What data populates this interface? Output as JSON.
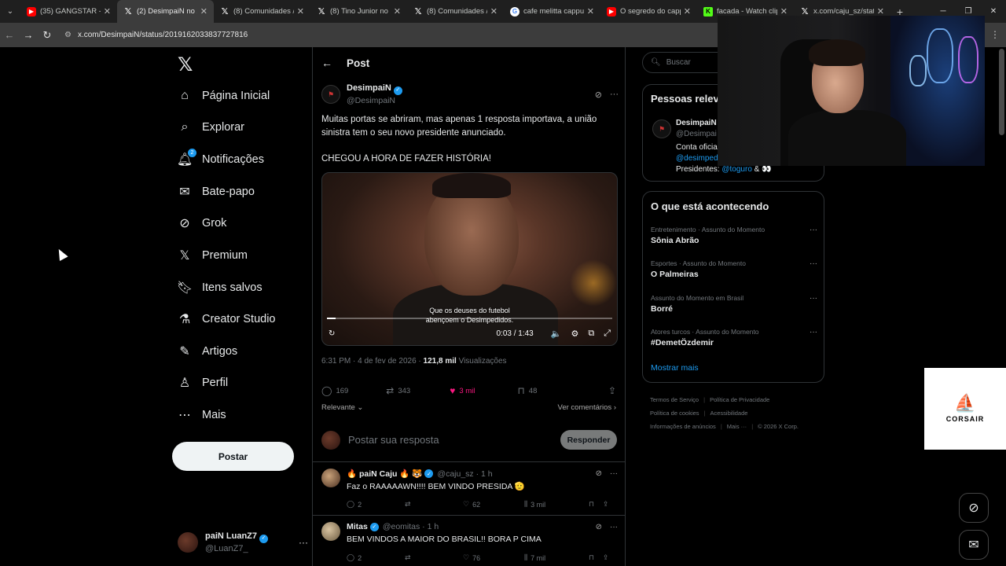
{
  "browser": {
    "tabs": [
      {
        "label": "(35) GANGSTAR - On",
        "favicon": "youtube-icon",
        "active": false
      },
      {
        "label": "(2) DesimpaiN no X:",
        "favicon": "x-icon",
        "active": true
      },
      {
        "label": "(8) Comunidades / X",
        "favicon": "x-icon",
        "active": false
      },
      {
        "label": "(8) Tino Junior no X:",
        "favicon": "x-icon",
        "active": false
      },
      {
        "label": "(8) Comunidades / X",
        "favicon": "x-icon",
        "active": false
      },
      {
        "label": "cafe melitta cappucc",
        "favicon": "google-icon",
        "active": false
      },
      {
        "label": "O segredo do cappu",
        "favicon": "youtube-icon",
        "active": false
      },
      {
        "label": "facada - Watch clips",
        "favicon": "kick-icon",
        "active": false
      },
      {
        "label": "x.com/caju_sz/status",
        "favicon": "x-icon",
        "active": false
      }
    ],
    "url": "x.com/DesimpaiN/status/2019162033837727816"
  },
  "nav": {
    "items": [
      {
        "label": "Página Inicial",
        "icon": "home-icon"
      },
      {
        "label": "Explorar",
        "icon": "search-icon"
      },
      {
        "label": "Notificações",
        "icon": "bell-icon",
        "badge": "2"
      },
      {
        "label": "Bate-papo",
        "icon": "mail-icon"
      },
      {
        "label": "Grok",
        "icon": "grok-icon"
      },
      {
        "label": "Premium",
        "icon": "x-icon"
      },
      {
        "label": "Itens salvos",
        "icon": "bookmark-icon"
      },
      {
        "label": "Creator Studio",
        "icon": "flask-icon"
      },
      {
        "label": "Artigos",
        "icon": "article-icon"
      },
      {
        "label": "Perfil",
        "icon": "person-icon"
      },
      {
        "label": "Mais",
        "icon": "more-circle-icon"
      }
    ],
    "post_button": "Postar",
    "account": {
      "name": "paiN LuanZ7",
      "handle": "@LuanZ7_"
    }
  },
  "post": {
    "header_title": "Post",
    "author": {
      "name": "DesimpaiN",
      "handle": "@DesimpaiN"
    },
    "text_lines": [
      "Muitas portas se abriram, mas apenas 1 resposta importava, a união sinistra tem o seu novo presidente anunciado.",
      "CHEGOU A HORA DE FAZER HISTÓRIA!"
    ],
    "video": {
      "subtitle_line1": "Que os deuses do futebol",
      "subtitle_line2": "abençoem o Desimpedidos.",
      "time": "0:03 / 1:43",
      "progress": 0.03
    },
    "meta_time": "6:31 PM · 4 de fev de 2026 · ",
    "views_count": "121,8 mil",
    "views_label": " Visualizações",
    "stats": {
      "replies": "169",
      "reposts": "343",
      "likes": "3 mil",
      "bookmarks": "48"
    },
    "sort_label": "Relevante",
    "view_comments": "Ver comentários",
    "reply_placeholder": "Postar sua resposta",
    "reply_button": "Responder"
  },
  "replies": [
    {
      "name": "🔥 paiN Caju 🔥 🐯",
      "handle": "@caju_sz · 1 h",
      "text": "Faz o RAAAAAWN!!!! BEM VINDO PRESIDA 🫡",
      "replies": "2",
      "reposts": "",
      "likes": "62",
      "views": "3 mil"
    },
    {
      "name": "Mitas",
      "handle": "@eomitas · 1 h",
      "text": "BEM VINDOS A MAIOR DO BRASIL!! BORA P CIMA",
      "replies": "2",
      "reposts": "",
      "likes": "76",
      "views": "7 mil"
    }
  ],
  "sidebar": {
    "search_placeholder": "Buscar",
    "people_title": "Pessoas relev",
    "person": {
      "name": "DesimpaiN",
      "handle": "@Desimpai",
      "bio": "Conta oficia",
      "bio_link": "@desimped",
      "presidents_label": "Presidentes: ",
      "presidents_link": "@toguro",
      "presidents_tail": " & 👀"
    },
    "trends_title": "O que está acontecendo",
    "trends": [
      {
        "context": "Entretenimento · Assunto do Momento",
        "name": "Sônia Abrão"
      },
      {
        "context": "Esportes · Assunto do Momento",
        "name": "O Palmeiras"
      },
      {
        "context": "Assunto do Momento em Brasil",
        "name": "Borré"
      },
      {
        "context": "Atores turcos · Assunto do Momento",
        "name": "#DemetÖzdemir"
      }
    ],
    "show_more": "Mostrar mais",
    "footer": [
      "Termos de Serviço",
      "Política de Privacidade",
      "Política de cookies",
      "Acessibilidade",
      "Informações de anúncios",
      "Mais ···",
      "© 2026 X Corp."
    ]
  },
  "overlay": {
    "corsair_text": "CORSAIR"
  }
}
